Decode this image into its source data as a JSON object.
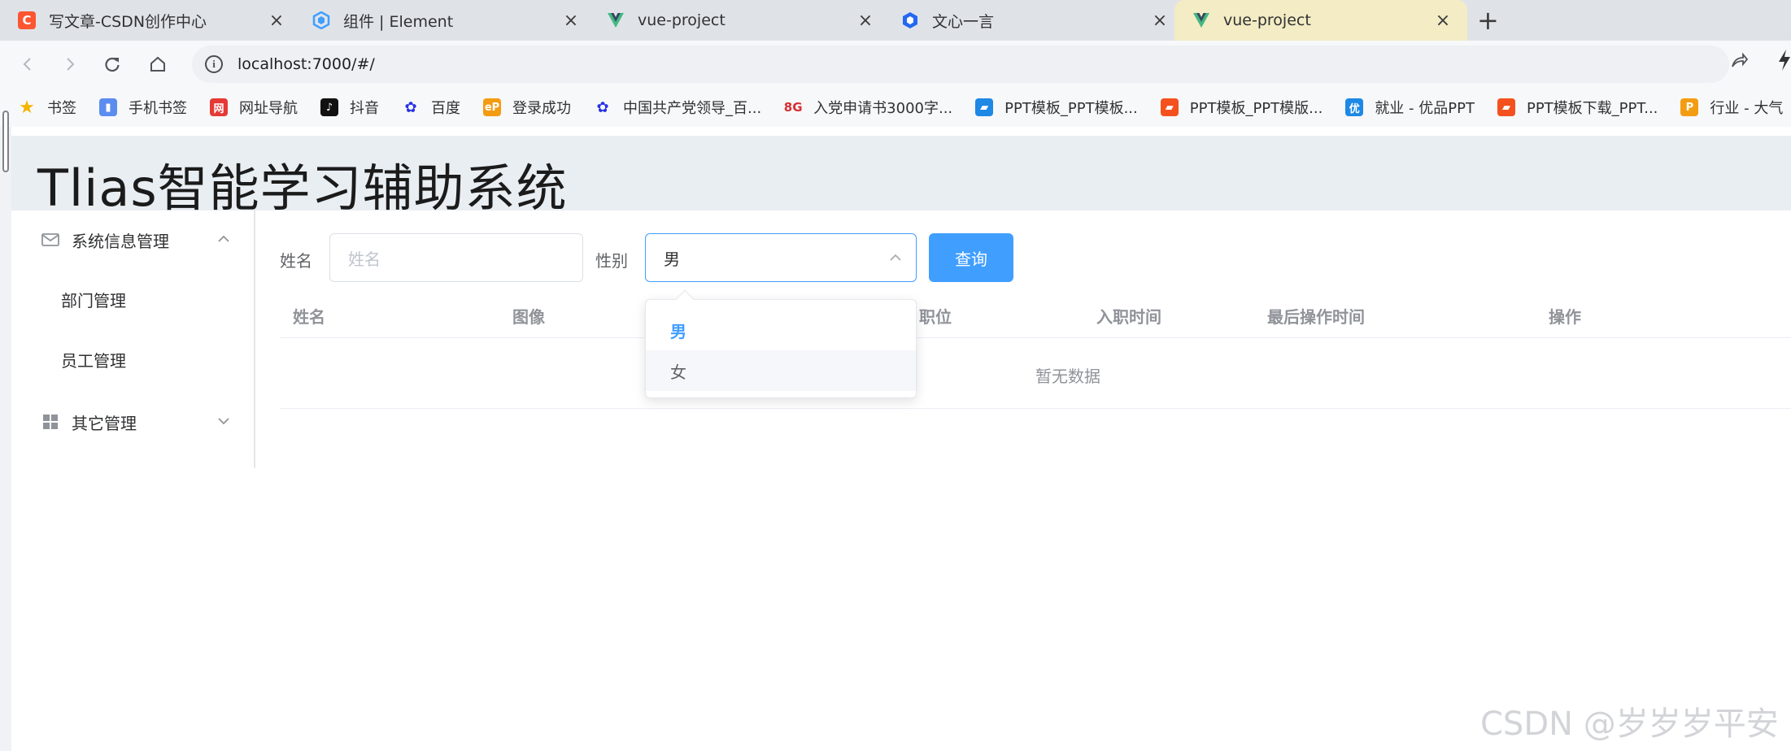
{
  "browser": {
    "tabs": [
      {
        "title": "写文章-CSDN创作中心",
        "icon": "csdn-icon",
        "color": "#fc5531",
        "active": false
      },
      {
        "title": "组件 | Element",
        "icon": "element-icon",
        "color": "#409eff",
        "active": false
      },
      {
        "title": "vue-project",
        "icon": "vue-icon",
        "color": "#42b883",
        "active": false
      },
      {
        "title": "文心一言",
        "icon": "wenxin-icon",
        "color": "#2468f2",
        "active": false
      },
      {
        "title": "vue-project",
        "icon": "vue-icon",
        "color": "#42b883",
        "active": true
      }
    ],
    "new_tab": "+",
    "url": "localhost:7000/#/",
    "bookmarks": [
      {
        "label": "书签",
        "icon": "star-icon",
        "color": "#f4b400"
      },
      {
        "label": "手机书签",
        "icon": "phone-icon",
        "color": "#5b8def"
      },
      {
        "label": "网址导航",
        "icon": "nav-icon",
        "color": "#e53935"
      },
      {
        "label": "抖音",
        "icon": "douyin-icon",
        "color": "#111111"
      },
      {
        "label": "百度",
        "icon": "baidu-icon",
        "color": "#2932e1"
      },
      {
        "label": "登录成功",
        "icon": "ep-icon",
        "color": "#f39c12"
      },
      {
        "label": "中国共产党领导_百...",
        "icon": "baidu-icon",
        "color": "#2932e1"
      },
      {
        "label": "入党申请书3000字...",
        "icon": "8g-icon",
        "color": "#d63031"
      },
      {
        "label": "PPT模板_PPT模板...",
        "icon": "ppt-icon",
        "color": "#1e88e5"
      },
      {
        "label": "PPT模板_PPT模版...",
        "icon": "ppt-icon",
        "color": "#f4511e"
      },
      {
        "label": "就业 - 优品PPT",
        "icon": "youpin-icon",
        "color": "#1e88e5"
      },
      {
        "label": "PPT模板下载_PPT...",
        "icon": "ppt-icon",
        "color": "#f4511e"
      },
      {
        "label": "行业 - 大气",
        "icon": "p-icon",
        "color": "#f39c12"
      }
    ]
  },
  "app": {
    "title": "Tlias智能学习辅助系统"
  },
  "sidebar": {
    "group1": {
      "label": "系统信息管理",
      "expanded": true
    },
    "items": [
      {
        "label": "部门管理"
      },
      {
        "label": "员工管理"
      }
    ],
    "group2": {
      "label": "其它管理",
      "expanded": false
    }
  },
  "search": {
    "name_label": "姓名",
    "name_placeholder": "姓名",
    "gender_label": "性别",
    "gender_value": "男",
    "query_button": "查询"
  },
  "gender_options": [
    {
      "label": "男",
      "selected": true
    },
    {
      "label": "女",
      "selected": false
    }
  ],
  "table": {
    "columns": [
      "姓名",
      "图像",
      "职位",
      "入职时间",
      "最后操作时间",
      "操作"
    ],
    "empty_text": "暂无数据"
  },
  "watermark": "CSDN @岁岁岁平安",
  "colors": {
    "primary": "#409eff",
    "header_bg": "#e9eef3"
  }
}
